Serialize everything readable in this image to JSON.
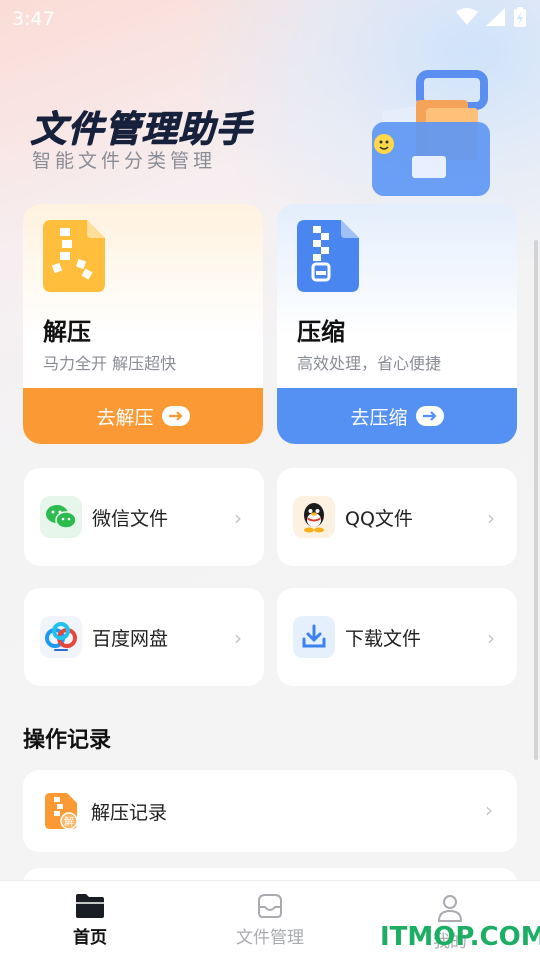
{
  "status": {
    "time": "3:47"
  },
  "header": {
    "title": "文件管理助手",
    "subtitle": "智能文件分类管理"
  },
  "cards": [
    {
      "title": "解压",
      "desc": "马力全开 解压超快",
      "button": "去解压",
      "accent": "#fb9a35"
    },
    {
      "title": "压缩",
      "desc": "高效处理，省心便捷",
      "button": "去压缩",
      "accent": "#5590f3"
    }
  ],
  "tiles": [
    {
      "label": "微信文件",
      "icon": "wechat-icon"
    },
    {
      "label": "QQ文件",
      "icon": "qq-icon"
    },
    {
      "label": "百度网盘",
      "icon": "baidu-netdisk-icon"
    },
    {
      "label": "下载文件",
      "icon": "download-icon"
    }
  ],
  "records": {
    "section_title": "操作记录",
    "items": [
      {
        "label": "解压记录",
        "icon": "unzip-record-icon"
      }
    ]
  },
  "tabbar": {
    "items": [
      {
        "label": "首页",
        "icon": "folder-icon",
        "active": true
      },
      {
        "label": "文件管理",
        "icon": "file-manage-icon",
        "active": false
      },
      {
        "label": "我的",
        "icon": "person-icon",
        "active": false
      }
    ]
  },
  "watermark": "ITMOP.COM"
}
